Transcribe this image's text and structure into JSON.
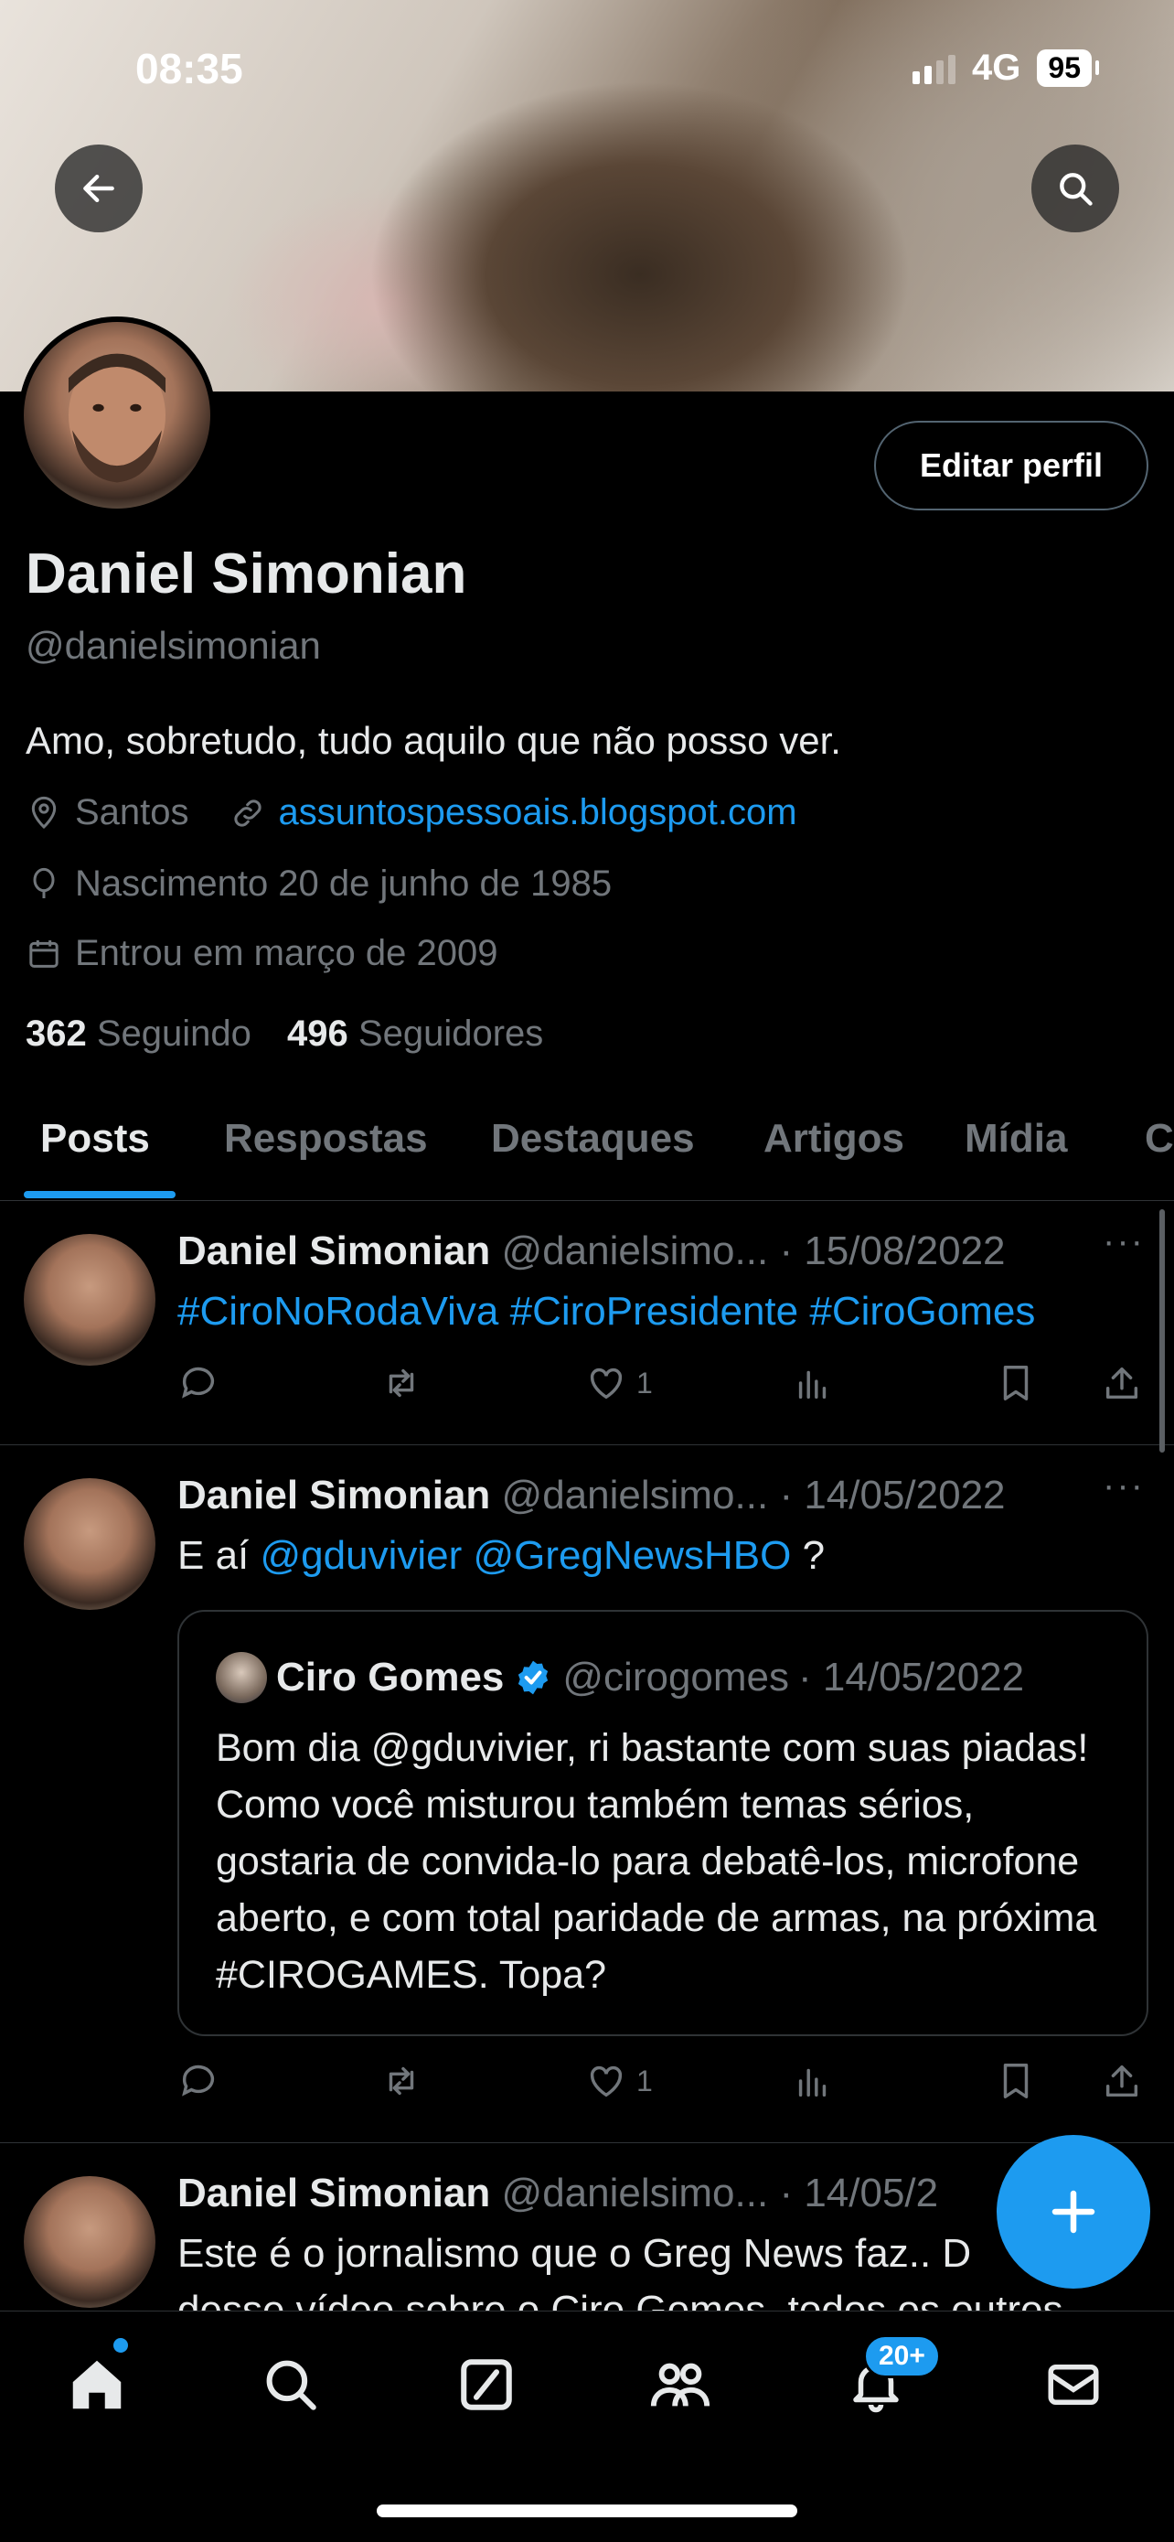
{
  "status_bar": {
    "time": "08:35",
    "network": "4G",
    "battery": "95"
  },
  "profile": {
    "name": "Daniel Simonian",
    "handle": "@danielsimonian",
    "edit_label": "Editar perfil",
    "bio": "Amo, sobretudo, tudo aquilo que não posso ver.",
    "location": "Santos",
    "website": "assuntospessoais.blogspot.com",
    "birth": "Nascimento 20 de junho de 1985",
    "joined": "Entrou em março de 2009",
    "following_count": "362",
    "following_label": "Seguindo",
    "followers_count": "496",
    "followers_label": "Seguidores"
  },
  "tabs": [
    {
      "label": "Posts",
      "active": true
    },
    {
      "label": "Respostas"
    },
    {
      "label": "Destaques"
    },
    {
      "label": "Artigos"
    },
    {
      "label": "Mídia"
    },
    {
      "label": "C"
    }
  ],
  "posts": [
    {
      "author": "Daniel Simonian",
      "handle": "@danielsimo...",
      "date": "· 15/08/2022",
      "text": [
        "#CiroNoRodaViva",
        "#CiroPresidente",
        "#CiroGomes"
      ],
      "likes": "1"
    },
    {
      "author": "Daniel Simonian",
      "handle": "@danielsimo...",
      "date": "· 14/05/2022",
      "text_prefix": "E aí",
      "mentions": [
        "@gduvivier",
        "@GregNewsHBO"
      ],
      "text_suffix": "?",
      "likes": "1",
      "quote": {
        "author": "Ciro Gomes",
        "handle": "@cirogomes",
        "date": "· 14/05/2022",
        "text": "Bom dia @gduvivier, ri bastante com suas piadas! Como você misturou também temas sérios, gostaria de convida-lo para debatê-los, microfone aberto, e com total paridade de armas, na próxima #CIROGAMES. Topa?"
      }
    },
    {
      "author": "Daniel Simonian",
      "handle": "@danielsimo...",
      "date": "· 14/05/2",
      "text": "Este é o jornalismo que o Greg News faz.. D",
      "text_line2": "desse vídeo sobre o Ciro Gomes, todos os outros"
    }
  ],
  "more_icon": "···",
  "notifications_badge": "20+",
  "colors": {
    "accent": "#1d9bf0",
    "background": "#000000",
    "muted": "#71767b"
  }
}
